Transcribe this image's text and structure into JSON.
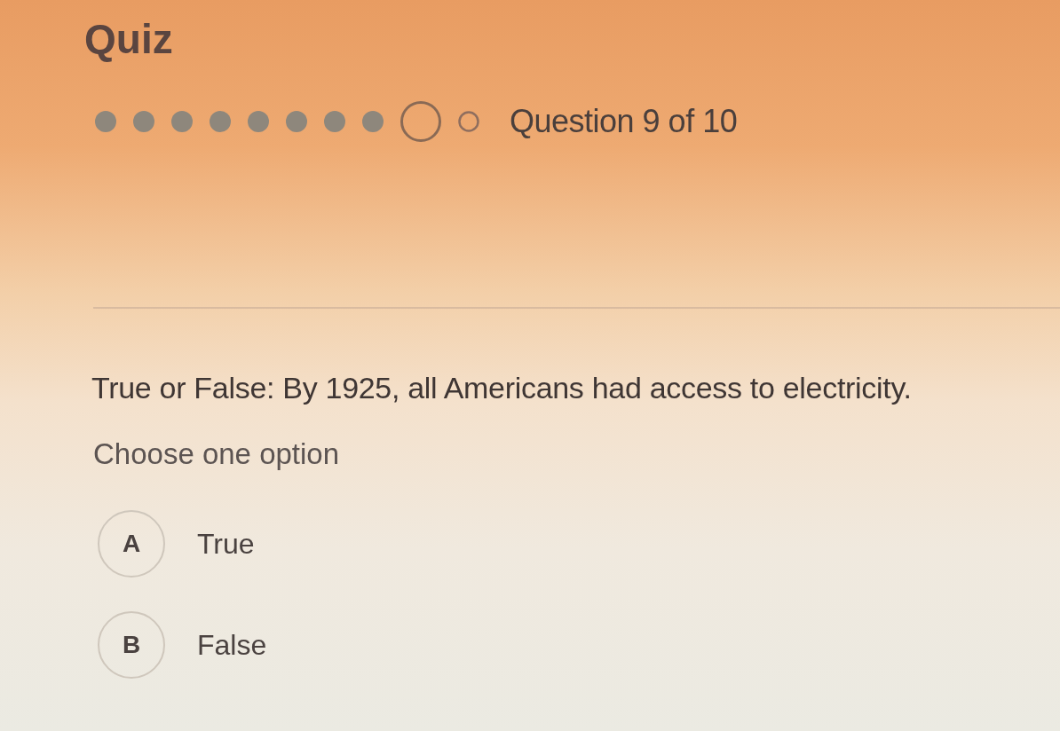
{
  "title": "Quiz",
  "progress": {
    "steps": [
      {
        "kind": "done"
      },
      {
        "kind": "done"
      },
      {
        "kind": "done"
      },
      {
        "kind": "done"
      },
      {
        "kind": "done"
      },
      {
        "kind": "done"
      },
      {
        "kind": "done"
      },
      {
        "kind": "done"
      },
      {
        "kind": "current"
      },
      {
        "kind": "upcoming"
      }
    ],
    "label": "Question 9 of 10"
  },
  "question": {
    "text": "True or False: By 1925, all Americans had access to electricity.",
    "instruction": "Choose one option"
  },
  "options": [
    {
      "letter": "A",
      "label": "True",
      "selected": false
    },
    {
      "letter": "B",
      "label": "False",
      "selected": false
    }
  ]
}
